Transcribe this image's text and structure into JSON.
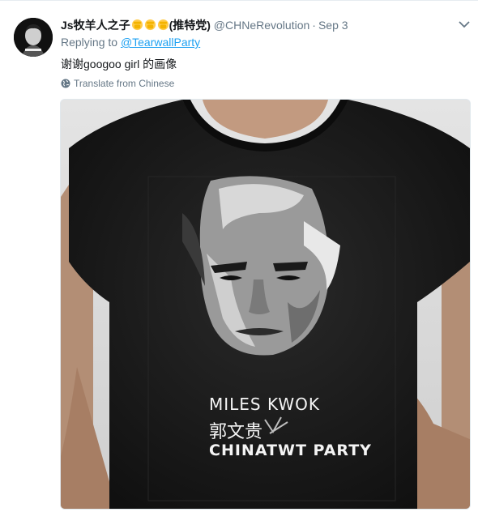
{
  "tweet": {
    "display_name": "Js牧羊人之子",
    "fist_emojis": [
      "fist-icon",
      "fist-icon",
      "fist-icon"
    ],
    "party_label": "(推特党)",
    "handle": "@CHNeRevolution",
    "separator": "·",
    "date": "Sep 3",
    "replying_prefix": "Replying to",
    "replying_handle": "@TearwallParty",
    "text": "谢谢googoo girl 的画像",
    "translate_label": "Translate from Chinese",
    "avatar_icon": "avatar-portrait",
    "menu_icon": "chevron-down-icon",
    "globe_icon": "globe-icon"
  },
  "media": {
    "line1": "MILES KWOK",
    "line2": "郭文贵",
    "line3": "CHINATWT PARTY"
  },
  "colors": {
    "link": "#1da1f2",
    "secondary": "#657786",
    "text": "#14171a",
    "shirt": "#1c1c1c"
  }
}
